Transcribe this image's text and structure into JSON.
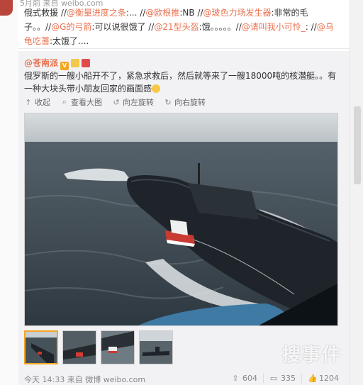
{
  "top_meta": "5月前 来自 weibo.com",
  "comment": {
    "prefix": "俄式救援 //",
    "segments": [
      {
        "user": "@衡量进度之条",
        "text": ":... //"
      },
      {
        "user": "@欧根推",
        "text": ":NB //"
      },
      {
        "user": "@玻色力场发生器",
        "text": ":非常的毛子。。//"
      },
      {
        "user": "@G的弓箭",
        "text": ":可以说很饿了 //"
      },
      {
        "user": "@21型头盔",
        "text": ":饿。。。。。//"
      },
      {
        "user": "@请叫我小可怜_",
        "text": ": //"
      },
      {
        "user": "@乌龟吃蓍",
        "text": ":太饿了...."
      }
    ]
  },
  "forward": {
    "author": "@苍南派",
    "badges": [
      "V",
      "👍",
      "🎁"
    ],
    "text": "俄罗斯的一艘小船开不了，紧急求救后，然后就等来了一艘18000吨的核潜艇。。有一种大块头带小朋友回家的画面感",
    "actions": [
      {
        "icon": "up-arrow",
        "label": "收起"
      },
      {
        "icon": "search",
        "label": "查看大图"
      },
      {
        "icon": "rotate-left",
        "label": "向左旋转"
      },
      {
        "icon": "rotate-right",
        "label": "向右旋转"
      }
    ]
  },
  "watermark": "搜事件",
  "footer": {
    "time": "今天 14:33",
    "from_label": "来自",
    "source": "微博 weibo.com",
    "shares": "604",
    "comments": "335",
    "likes": "1204"
  },
  "colors": {
    "link": "#eb7350",
    "forward_bg": "#f2f2f5",
    "sea": "#3f4a52",
    "sky": "#c9d0d3"
  }
}
